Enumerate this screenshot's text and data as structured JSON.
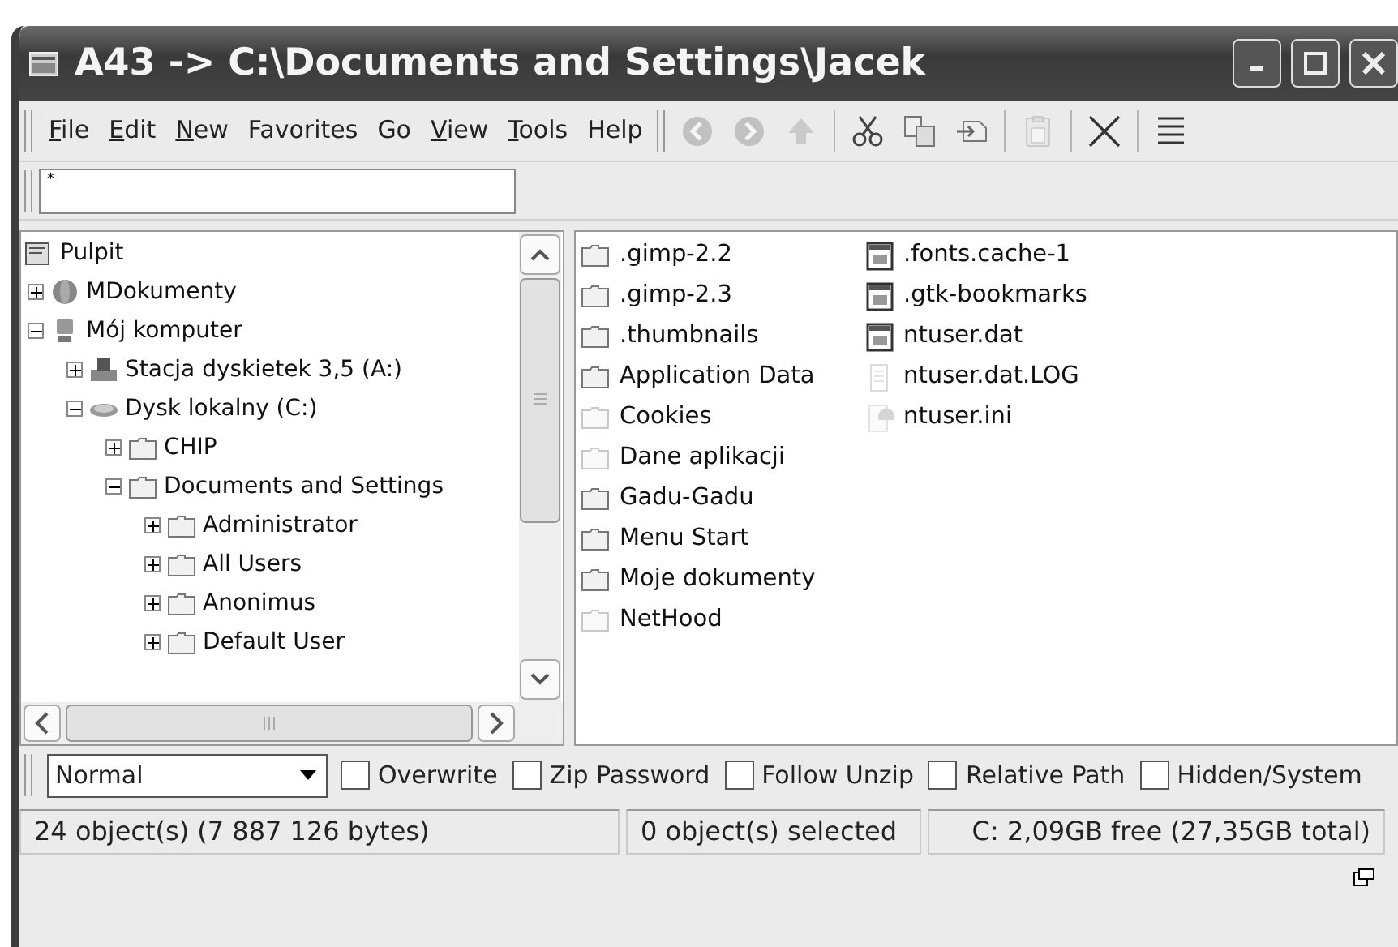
{
  "window": {
    "title": "A43 -> C:\\Documents and Settings\\Jacek"
  },
  "menu": [
    {
      "label": "File",
      "underline": true
    },
    {
      "label": "Edit",
      "underline": true
    },
    {
      "label": "New",
      "underline": true
    },
    {
      "label": "Favorites",
      "underline": false
    },
    {
      "label": "Go",
      "underline": false
    },
    {
      "label": "View",
      "underline": true
    },
    {
      "label": "Tools",
      "underline": true
    },
    {
      "label": "Help",
      "underline": false
    }
  ],
  "toolbar": [
    {
      "kind": "back",
      "disabled": true
    },
    {
      "kind": "forward",
      "disabled": true
    },
    {
      "kind": "up",
      "disabled": true
    },
    {
      "kind": "sep"
    },
    {
      "kind": "cut",
      "disabled": false
    },
    {
      "kind": "copy",
      "disabled": false
    },
    {
      "kind": "move",
      "disabled": false
    },
    {
      "kind": "sep"
    },
    {
      "kind": "paste",
      "disabled": true
    },
    {
      "kind": "sep"
    },
    {
      "kind": "delete",
      "disabled": false
    },
    {
      "kind": "sep"
    },
    {
      "kind": "list",
      "disabled": false
    }
  ],
  "address": {
    "value": "*"
  },
  "tree": [
    {
      "label": "Pulpit",
      "kind": "desktop",
      "children": [
        {
          "label": "MDokumenty",
          "kind": "globe",
          "expanded": false,
          "has_children": true
        },
        {
          "label": "Mój komputer",
          "kind": "computer",
          "expanded": true,
          "children": [
            {
              "label": "Stacja dyskietek 3,5 (A:)",
              "kind": "floppy",
              "expanded": false,
              "has_children": true
            },
            {
              "label": "Dysk lokalny (C:)",
              "kind": "drive",
              "expanded": true,
              "children": [
                {
                  "label": "CHIP",
                  "kind": "folder",
                  "expanded": false,
                  "has_children": true
                },
                {
                  "label": "Documents and Settings",
                  "kind": "folder",
                  "expanded": true,
                  "children": [
                    {
                      "label": "Administrator",
                      "kind": "folder",
                      "expanded": false,
                      "has_children": true
                    },
                    {
                      "label": "All Users",
                      "kind": "folder",
                      "expanded": false,
                      "has_children": true
                    },
                    {
                      "label": "Anonimus",
                      "kind": "folder",
                      "expanded": false,
                      "has_children": true
                    },
                    {
                      "label": "Default User",
                      "kind": "folder",
                      "expanded": false,
                      "has_children": true
                    }
                  ]
                }
              ]
            }
          ]
        }
      ]
    }
  ],
  "files": [
    [
      {
        "name": ".gimp-2.2",
        "kind": "folder",
        "hidden": false
      },
      {
        "name": ".gimp-2.3",
        "kind": "folder",
        "hidden": false
      },
      {
        "name": ".thumbnails",
        "kind": "folder",
        "hidden": false
      },
      {
        "name": "Application Data",
        "kind": "folder",
        "hidden": false
      },
      {
        "name": "Cookies",
        "kind": "folder",
        "hidden": true
      },
      {
        "name": "Dane aplikacji",
        "kind": "folder",
        "hidden": true
      },
      {
        "name": "Gadu-Gadu",
        "kind": "folder",
        "hidden": false
      },
      {
        "name": "Menu Start",
        "kind": "folder",
        "hidden": false
      },
      {
        "name": "Moje dokumenty",
        "kind": "folder",
        "hidden": false
      },
      {
        "name": "NetHood",
        "kind": "folder",
        "hidden": true
      }
    ],
    [
      {
        "name": ".fonts.cache-1",
        "kind": "app",
        "hidden": false
      },
      {
        "name": ".gtk-bookmarks",
        "kind": "app",
        "hidden": false
      },
      {
        "name": "ntuser.dat",
        "kind": "app",
        "hidden": false
      },
      {
        "name": "ntuser.dat.LOG",
        "kind": "text",
        "hidden": true
      },
      {
        "name": "ntuser.ini",
        "kind": "ini",
        "hidden": true
      }
    ]
  ],
  "options": {
    "mode": "Normal",
    "checks": [
      {
        "label": "Overwrite",
        "checked": false
      },
      {
        "label": "Zip Password",
        "checked": false
      },
      {
        "label": "Follow Unzip",
        "checked": false
      },
      {
        "label": "Relative Path",
        "checked": false
      },
      {
        "label": "Hidden/System",
        "checked": false
      }
    ]
  },
  "status_bar": [
    "24 object(s) (7 887 126 bytes)",
    "0 object(s) selected",
    "C: 2,09GB free (27,35GB total)"
  ]
}
